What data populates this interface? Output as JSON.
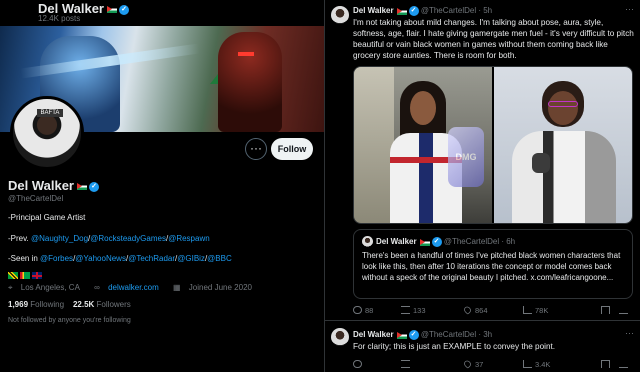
{
  "profile": {
    "header_name": "Del Walker",
    "posts_count": "12.4K posts",
    "name": "Del Walker",
    "handle": "@TheCartelDel",
    "bio_line1": "-Principal Game Artist",
    "bio_prev_label": "-Prev.",
    "bio_prev_links": [
      "@Naughty_Dog",
      "@RocksteadyGames",
      "@Respawn"
    ],
    "bio_seen_label": "-Seen in",
    "bio_seen_links": [
      "@Forbes",
      "@YahooNews",
      "@TechRadar",
      "@GIBiz",
      "@BBC"
    ],
    "avatar_sign": "BAFTA",
    "location": "Los Angeles, CA",
    "website": "delwalker.com",
    "joined": "Joined June 2020",
    "following_count": "1,969",
    "following_label": "Following",
    "followers_count": "22.5K",
    "followers_label": "Followers",
    "not_followed": "Not followed by anyone you're following",
    "follow_button": "Follow",
    "more_button": "···"
  },
  "post1": {
    "name": "Del Walker",
    "handle": "@TheCartelDel",
    "time": "· 5h",
    "text": "I'm not taking about mild changes. I'm talking about pose, aura, style, softness, age, flair. I hate giving gamergate men fuel - it's very difficult to pitch beautiful or vain black women in games without them coming back like grocery store aunties. There is room for both.",
    "media_badge": "DMG",
    "quote": {
      "name": "Del Walker",
      "handle": "@TheCartelDel",
      "time": "· 6h",
      "text": "There's been a handful of times I've pitched black women characters that look like this, then after 10 iterations the concept or model comes back without a speck of the original beauty I pitched. x.com/leafricangoone..."
    },
    "actions": {
      "replies": "88",
      "reposts": "133",
      "likes": "864",
      "views": "78K"
    }
  },
  "post2": {
    "name": "Del Walker",
    "handle": "@TheCartelDel",
    "time": "· 3h",
    "text": "For clarity; this is just an EXAMPLE to convey the point.",
    "actions": {
      "replies": "",
      "reposts": "",
      "likes": "37",
      "views": "3.4K"
    }
  },
  "colors": {
    "accent": "#1d9bf0",
    "text": "#e7e9ea",
    "muted": "#71767b",
    "border": "#2f3336",
    "background": "#000000"
  }
}
